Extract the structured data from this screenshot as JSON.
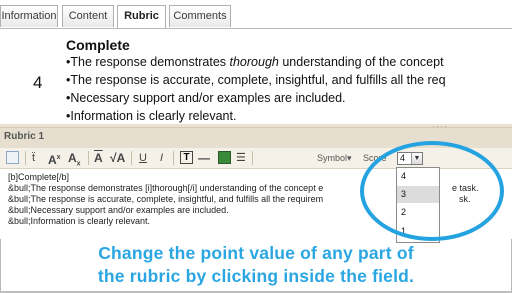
{
  "tabs": [
    "Information",
    "Content",
    "Rubric",
    "Comments"
  ],
  "active_tab": "Rubric",
  "preview": {
    "score": "4",
    "title": "Complete",
    "bullets": [
      "•The response demonstrates ",
      "thorough",
      " understanding of the concept",
      "•The response is accurate, complete, insightful, and fulfills all the req",
      "•Necessary support and/or examples are included.",
      "•Information is clearly relevant."
    ]
  },
  "editor": {
    "section_label": "Rubric 1",
    "toolbar": {
      "symbol_label": "Symbol▾",
      "score_label": "Score",
      "score_value": "4"
    },
    "source_lines": [
      "[b]Complete[/b]",
      "&bull;The response demonstrates [i]thorough[/i] understanding of the concept e",
      "e task.",
      "&bull;The response is accurate, complete, insightful, and fulfills all the requirem",
      "sk.",
      "&bull;Necessary support and/or examples are included.",
      "&bull;Information is clearly relevant."
    ],
    "score_options": [
      "4",
      "3",
      "2",
      "1"
    ],
    "highlighted_option": "3"
  },
  "caption": {
    "line1": "Change the point value of any part of",
    "line2": "the rubric by clicking inside the field."
  },
  "colors": {
    "accent": "#25a3e0",
    "header_bg": "#e6dfcf"
  }
}
